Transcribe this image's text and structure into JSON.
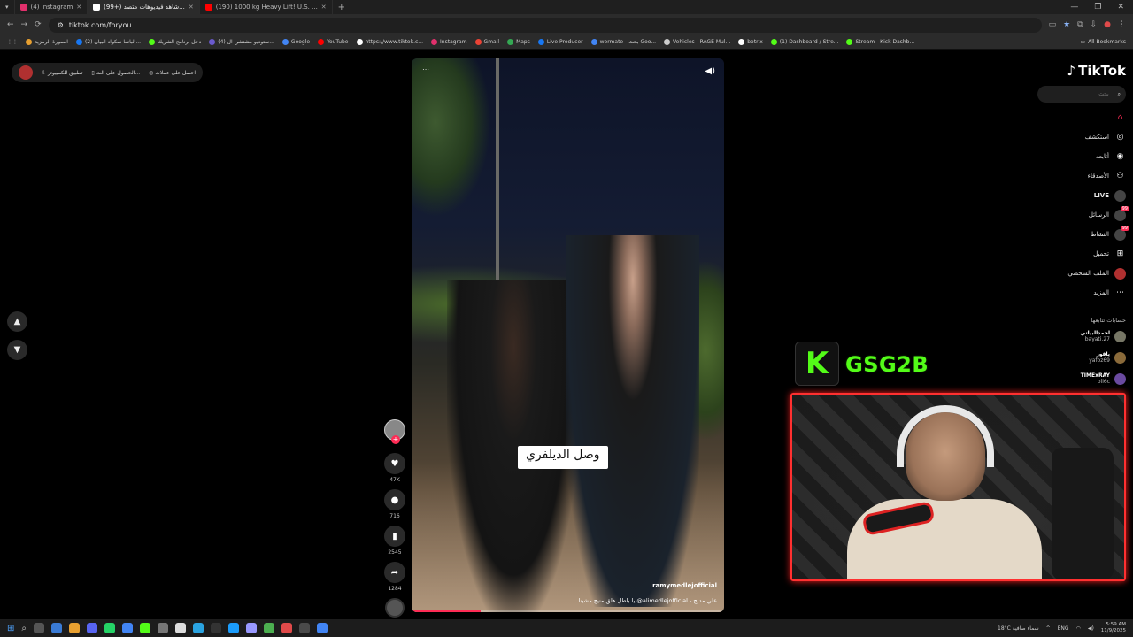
{
  "browser": {
    "tabs": [
      {
        "title": "(4) Instagram",
        "color": "#e1306c"
      },
      {
        "title": "(99+) شاهد فيديوهات متصد...",
        "color": "#ffffff"
      },
      {
        "title": "(190) 1000 kg Heavy Lift! U.S. ...",
        "color": "#ff0000"
      }
    ],
    "new_tab": "+",
    "url": "tiktok.com/foryou",
    "bookmarks": [
      {
        "label": "الصورة الرمزية",
        "color": "#e8a030"
      },
      {
        "label": "(2) الباشا سكواد البيان...",
        "color": "#1877f2"
      },
      {
        "label": "دخل برنامج الشريك",
        "color": "#53fc18"
      },
      {
        "label": "(4) ستوديو مشتشن ال...",
        "color": "#6a5acd"
      },
      {
        "label": "Google",
        "color": "#4285f4"
      },
      {
        "label": "YouTube",
        "color": "#ff0000"
      },
      {
        "label": "https://www.tiktok.c...",
        "color": "#ffffff"
      },
      {
        "label": "Instagram",
        "color": "#e1306c"
      },
      {
        "label": "Gmail",
        "color": "#ea4335"
      },
      {
        "label": "Maps",
        "color": "#34a853"
      },
      {
        "label": "Live Producer",
        "color": "#1877f2"
      },
      {
        "label": "wormate - بحث Goo...",
        "color": "#4285f4"
      },
      {
        "label": "Vehicles - RAGE Mul...",
        "color": "#cccccc"
      },
      {
        "label": "botrix",
        "color": "#ffffff"
      },
      {
        "label": "(1) Dashboard / Stre...",
        "color": "#53fc18"
      },
      {
        "label": "Stream - Kick Dashb...",
        "color": "#53fc18"
      }
    ],
    "all_bookmarks": "All Bookmarks"
  },
  "top_bar": {
    "items": [
      "احصل على عملات",
      "الحصول على الت...",
      "تطبيق للكمبيوتر"
    ]
  },
  "video": {
    "caption": "وصل الديلفري",
    "author": "ramymedlejofficial",
    "description": "يا باطل هلق منيح مشينا @alimedlejofficial - علي مدلج",
    "progress": 0.22
  },
  "actions": {
    "likes": "47K",
    "comments": "716",
    "saves": "2545",
    "shares": "1284"
  },
  "sidebar": {
    "logo": "TikTok",
    "search_placeholder": "بحث",
    "nav": [
      {
        "label": "",
        "icon": "home-icon"
      },
      {
        "label": "استكشف",
        "icon": "compass-icon"
      },
      {
        "label": "أتابعه",
        "icon": "following-icon"
      },
      {
        "label": "الأصدقاء",
        "icon": "friends-icon"
      },
      {
        "label": "LIVE",
        "icon": "live-icon"
      },
      {
        "label": "الرسائل",
        "icon": "messages-icon",
        "badge": "99"
      },
      {
        "label": "النشاط",
        "icon": "activity-icon",
        "badge": "99"
      },
      {
        "label": "تحميل",
        "icon": "upload-icon"
      },
      {
        "label": "الملف الشخصي",
        "icon": "profile-icon"
      },
      {
        "label": "المزيد",
        "icon": "more-icon"
      }
    ],
    "following_title": "حسابات تتابعها",
    "following": [
      {
        "name": "احمدالبياتي",
        "handle": "bayati.27"
      },
      {
        "name": "ياقوز",
        "handle": "yafoz69"
      },
      {
        "name": "TIMExRAY",
        "handle": "oli6c"
      }
    ]
  },
  "stream": {
    "kick_letter": "K",
    "channel": "GSG2B"
  },
  "taskbar": {
    "weather": "18°C سماء صافية",
    "lang": "ENG",
    "time": "5:59 AM",
    "date": "11/9/2025"
  }
}
